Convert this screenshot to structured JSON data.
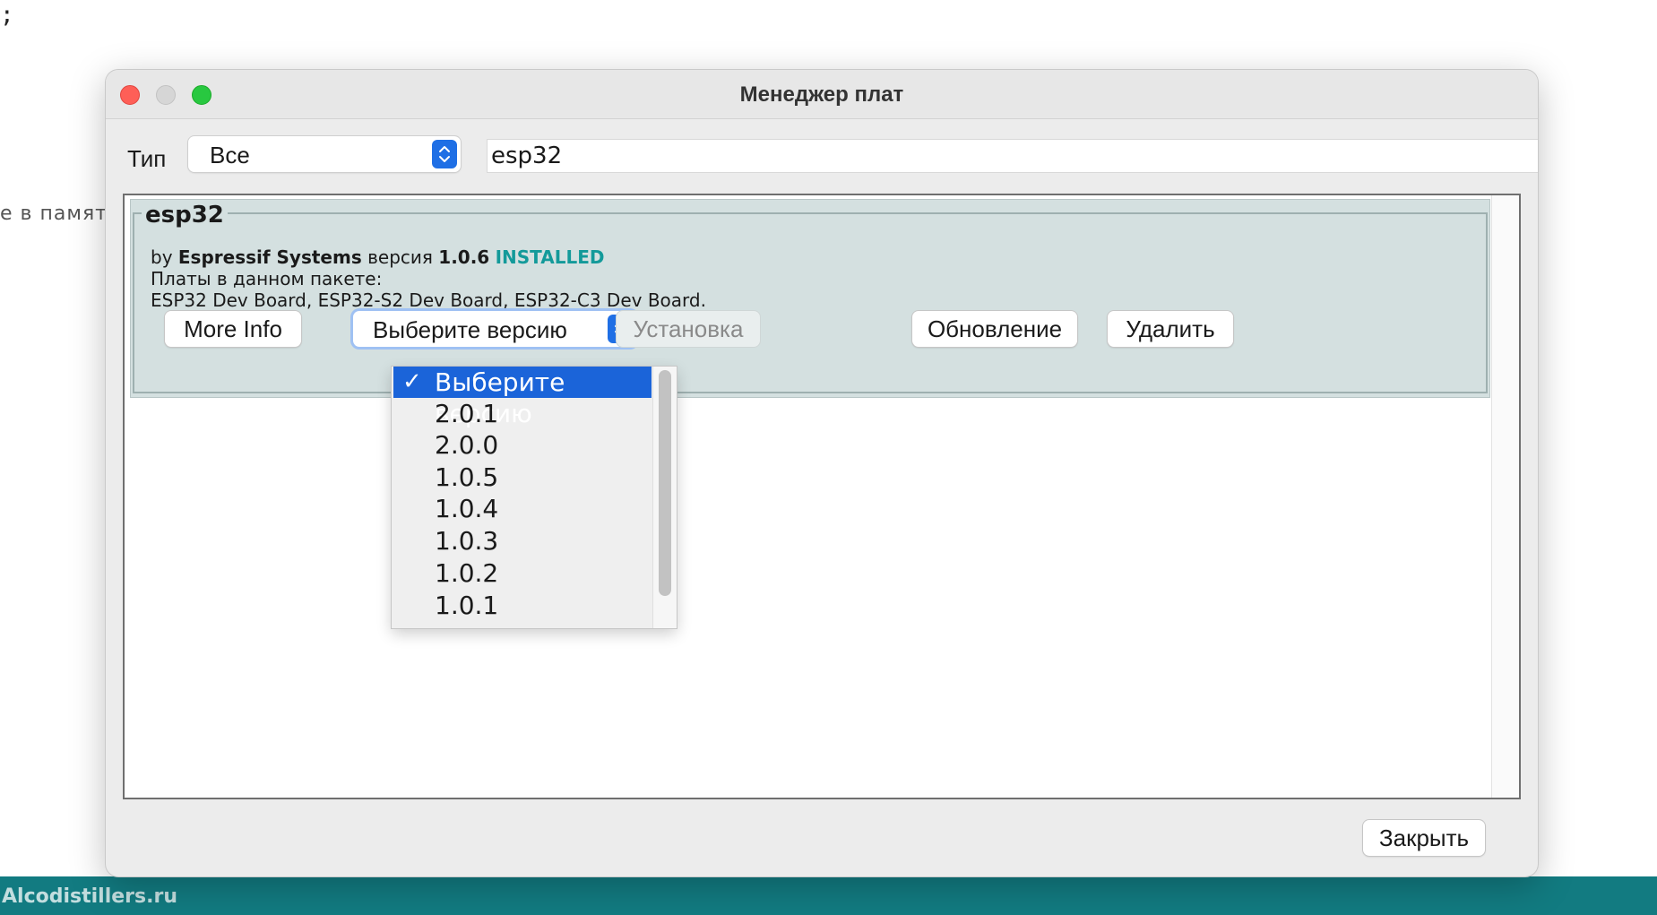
{
  "background": {
    "semicolon": ";",
    "side_text": "е в памят",
    "watermark": "Alcodistillers.ru"
  },
  "window": {
    "title": "Менеджер плат"
  },
  "filter": {
    "type_label": "Тип",
    "type_value": "Все",
    "search_value": "esp32"
  },
  "package": {
    "name": "esp32",
    "by_label": "by",
    "author": "Espressif Systems",
    "version_label": "версия",
    "version": "1.0.6",
    "status": "INSTALLED",
    "boards_heading": "Платы в данном пакете:",
    "boards_list": "ESP32 Dev Board, ESP32-S2 Dev Board, ESP32-C3 Dev Board."
  },
  "actions": {
    "more_info": "More Info",
    "version_select": "Выберите версию",
    "install": "Установка",
    "update": "Обновление",
    "remove": "Удалить",
    "close": "Закрыть"
  },
  "version_dropdown": {
    "check_mark": "✓",
    "selected_index": 0,
    "options": [
      "Выберите версию",
      "2.0.1",
      "2.0.0",
      "1.0.5",
      "1.0.4",
      "1.0.3",
      "1.0.2",
      "1.0.1"
    ]
  },
  "colors": {
    "accent": "#1f6fe5",
    "selection": "#1b64d9",
    "installed": "#139a9a",
    "package_bg": "#d4e0e0",
    "bottom_bar": "#127b81"
  }
}
